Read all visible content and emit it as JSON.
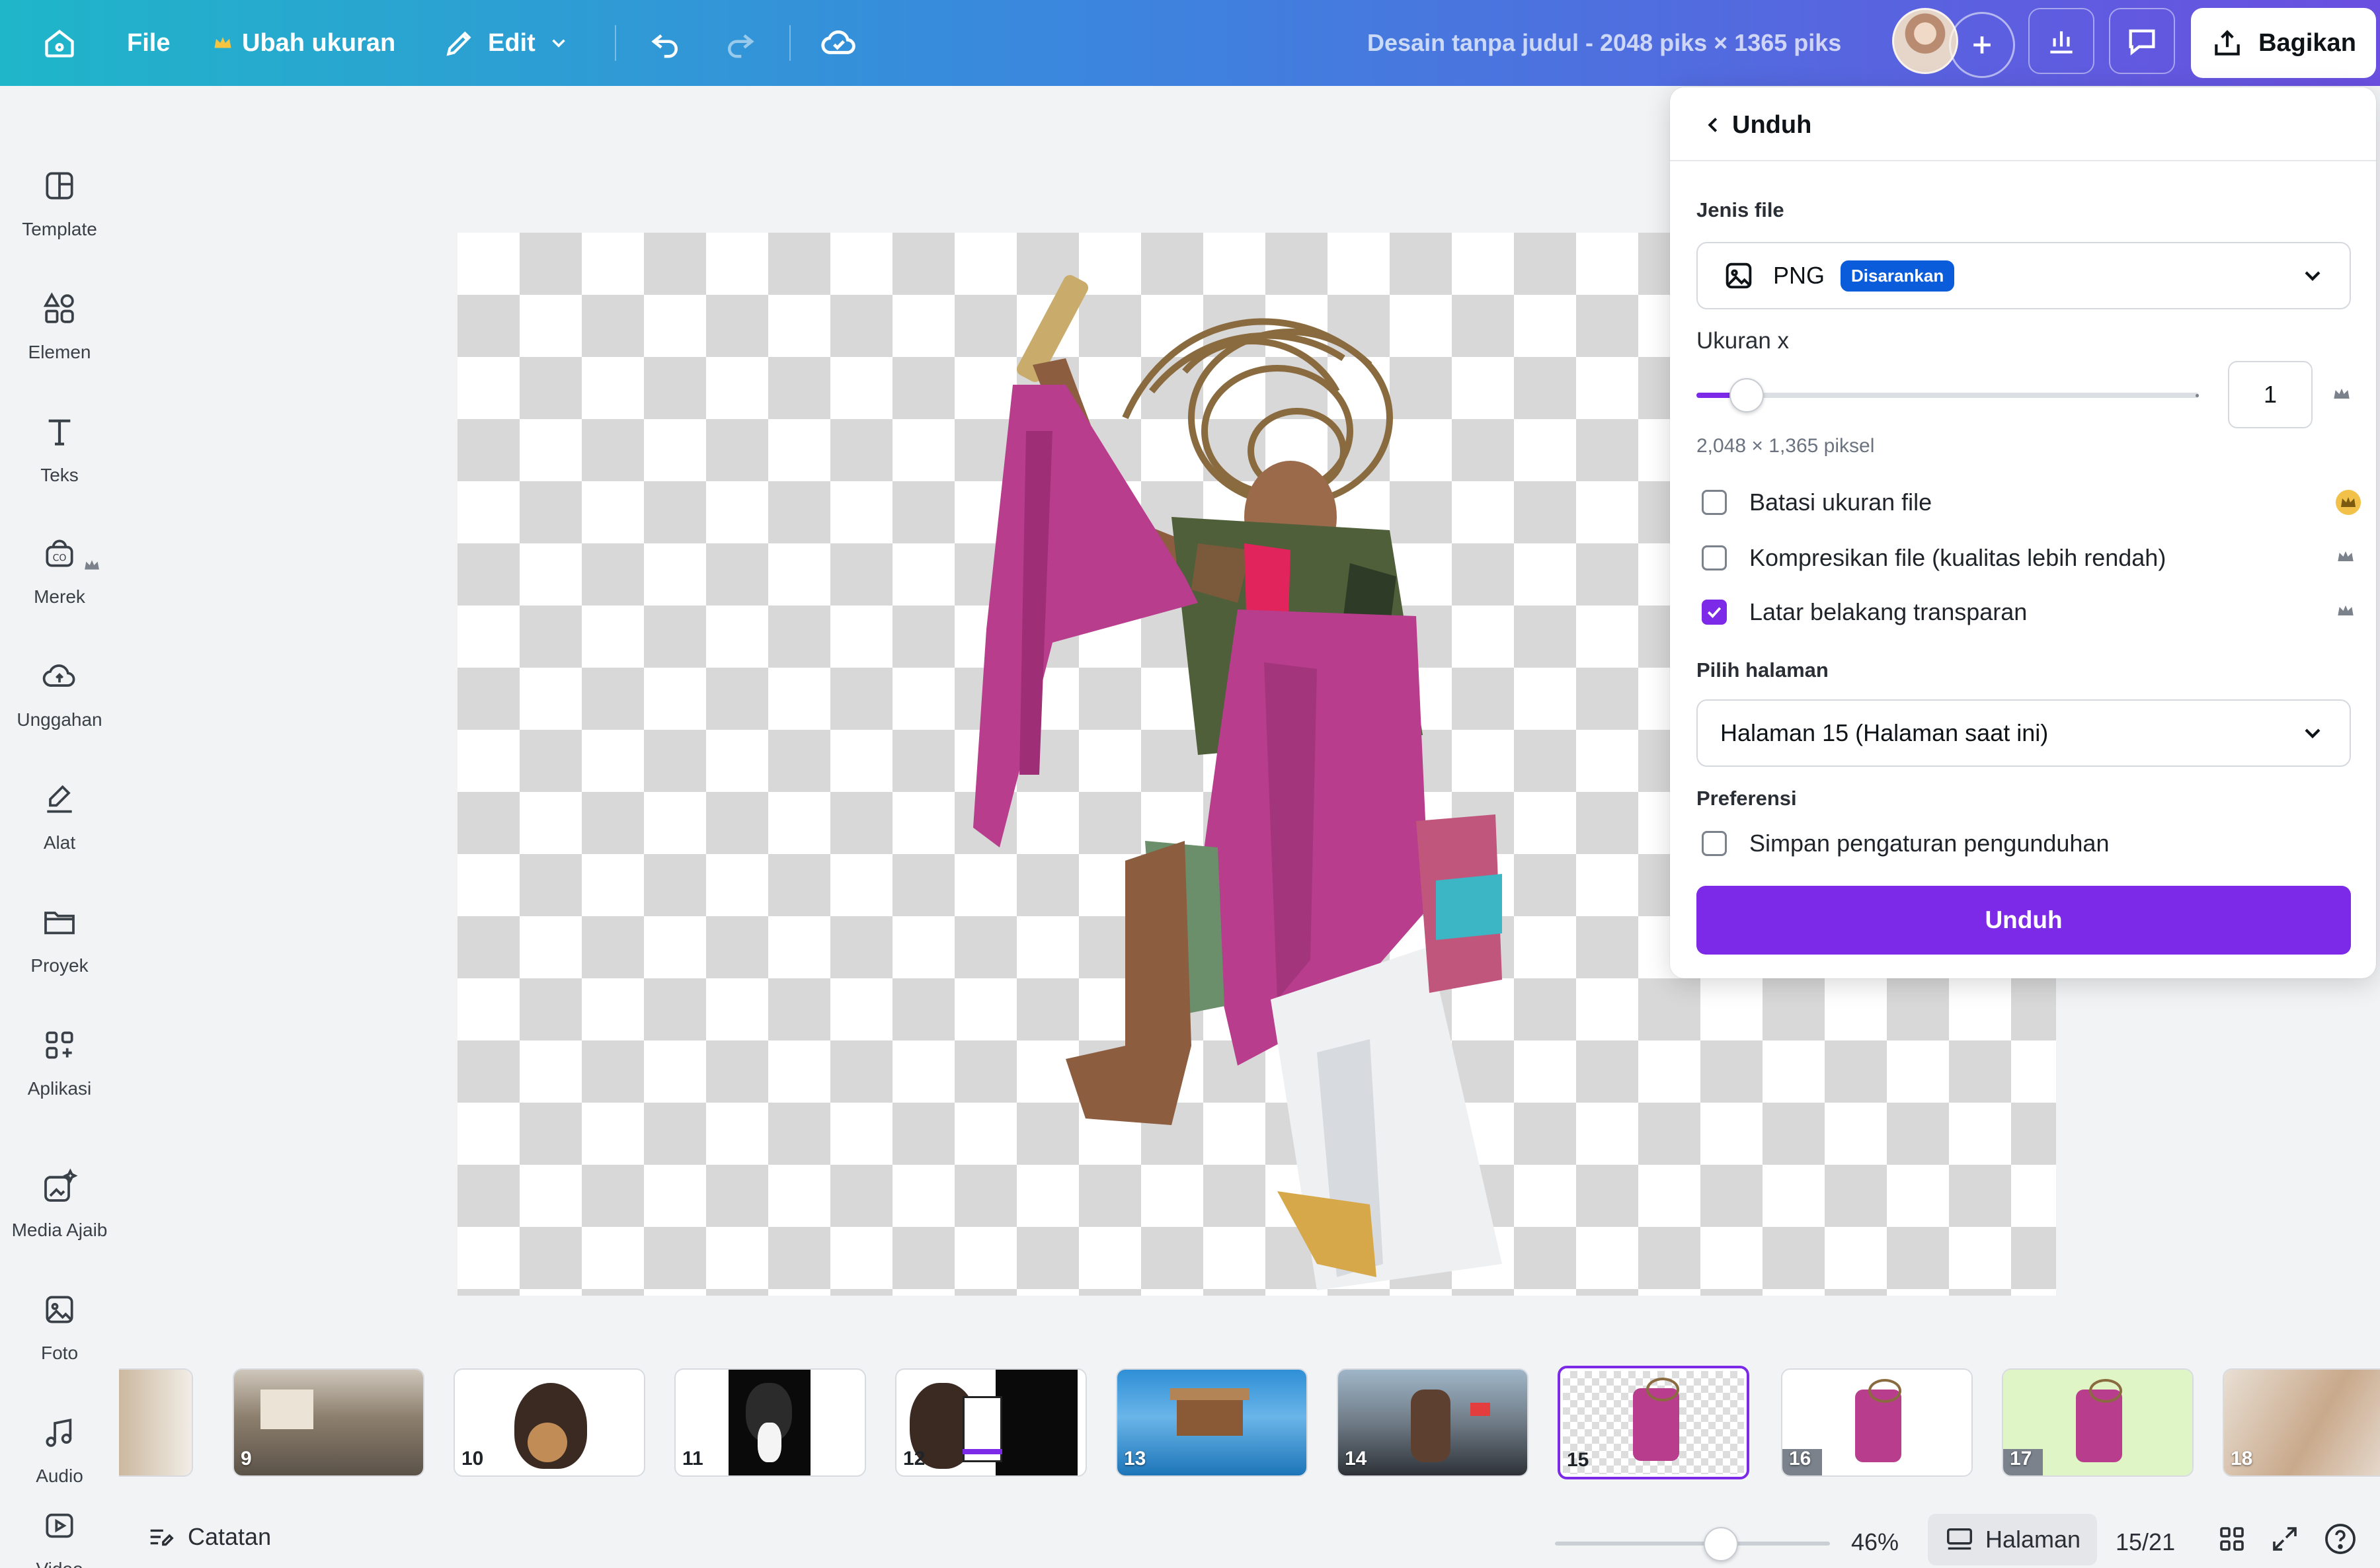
{
  "topbar": {
    "file_label": "File",
    "resize_label": "Ubah ukuran",
    "edit_label": "Edit",
    "document_title": "Desain tanpa judul - 2048 piks × 1365 piks",
    "share_label": "Bagikan"
  },
  "sidebar": {
    "items": [
      {
        "label": "Template",
        "icon": "template-icon"
      },
      {
        "label": "Elemen",
        "icon": "elements-icon"
      },
      {
        "label": "Teks",
        "icon": "text-icon"
      },
      {
        "label": "Merek",
        "icon": "brand-icon"
      },
      {
        "label": "Unggahan",
        "icon": "upload-icon"
      },
      {
        "label": "Alat",
        "icon": "draw-icon"
      },
      {
        "label": "Proyek",
        "icon": "folder-icon"
      },
      {
        "label": "Aplikasi",
        "icon": "apps-icon"
      },
      {
        "label": "Media Ajaib",
        "icon": "magic-media-icon"
      },
      {
        "label": "Foto",
        "icon": "photo-icon"
      },
      {
        "label": "Audio",
        "icon": "audio-icon"
      },
      {
        "label": "Video",
        "icon": "video-icon"
      }
    ]
  },
  "download_panel": {
    "title": "Unduh",
    "file_type_label": "Jenis file",
    "file_type_value": "PNG",
    "recommended_badge": "Disarankan",
    "size_label": "Ukuran x",
    "size_value": "1",
    "size_fraction": 0.1,
    "pixel_info": "2,048 × 1,365 piksel",
    "options": [
      {
        "label": "Batasi ukuran file",
        "checked": false
      },
      {
        "label": "Kompresikan file (kualitas lebih rendah)",
        "checked": false
      },
      {
        "label": "Latar belakang transparan",
        "checked": true
      }
    ],
    "page_select_label": "Pilih halaman",
    "page_select_value": "Halaman 15 (Halaman saat ini)",
    "preferences_label": "Preferensi",
    "save_settings_label": "Simpan pengaturan pengunduhan",
    "download_button": "Unduh"
  },
  "pages": [
    {
      "num": "",
      "active": false
    },
    {
      "num": "9",
      "active": false
    },
    {
      "num": "10",
      "active": false
    },
    {
      "num": "11",
      "active": false
    },
    {
      "num": "12",
      "active": false
    },
    {
      "num": "13",
      "active": false
    },
    {
      "num": "14",
      "active": false
    },
    {
      "num": "15",
      "active": true
    },
    {
      "num": "16",
      "active": false
    },
    {
      "num": "17",
      "active": false
    },
    {
      "num": "18",
      "active": false
    }
  ],
  "bottombar": {
    "notes_label": "Catatan",
    "zoom_fraction": 0.46,
    "zoom_value": "46%",
    "pages_label": "Halaman",
    "page_count": "15/21"
  },
  "colors": {
    "accent": "#7d2ae8",
    "badge": "#0b5cdb",
    "topbar_start": "#1fb6c9",
    "topbar_end": "#6a4fe0"
  }
}
